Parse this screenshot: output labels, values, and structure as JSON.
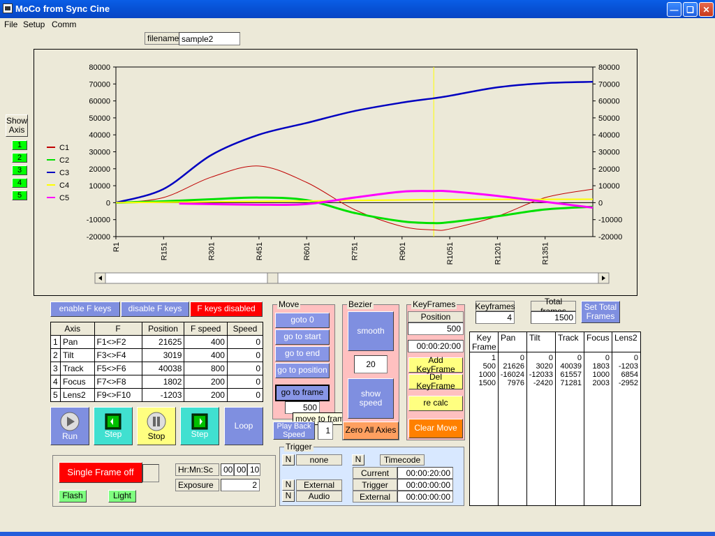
{
  "window": {
    "title": "MoCo from Sync Cine"
  },
  "menu": [
    "File",
    "Setup",
    "Comm"
  ],
  "filename": {
    "label": "filename",
    "value": "sample2"
  },
  "show_axis": {
    "label": "Show Axis",
    "buttons": [
      "1",
      "2",
      "3",
      "4",
      "5"
    ]
  },
  "chart_data": {
    "type": "line",
    "xlabels": [
      "R1",
      "R151",
      "R301",
      "R451",
      "R601",
      "R751",
      "R901",
      "R1051",
      "R1201",
      "R1351"
    ],
    "xrange": [
      1,
      1500
    ],
    "ylim": [
      -20000,
      80000
    ],
    "yticks": [
      "80000",
      "70000",
      "60000",
      "50000",
      "40000",
      "30000",
      "20000",
      "10000",
      "0",
      "-10000",
      "-20000"
    ],
    "cursor_frame": 1000,
    "series": [
      {
        "name": "C1",
        "color": "#c00000",
        "x": [
          1,
          150,
          300,
          450,
          600,
          750,
          900,
          1000,
          1050,
          1200,
          1350,
          1500
        ],
        "y": [
          0,
          3000,
          15000,
          21626,
          12000,
          -4000,
          -14000,
          -16024,
          -15500,
          -8000,
          3000,
          7976
        ]
      },
      {
        "name": "C2",
        "color": "#00e000",
        "x": [
          1,
          150,
          300,
          450,
          600,
          750,
          900,
          1000,
          1050,
          1200,
          1350,
          1500
        ],
        "y": [
          0,
          800,
          2000,
          3019,
          1500,
          -6000,
          -11000,
          -12033,
          -11500,
          -8000,
          -4000,
          -2420
        ]
      },
      {
        "name": "C3",
        "color": "#0000c0",
        "x": [
          1,
          150,
          300,
          450,
          600,
          750,
          900,
          1000,
          1050,
          1200,
          1350,
          1500
        ],
        "y": [
          0,
          8000,
          28000,
          40038,
          47000,
          54000,
          59000,
          61557,
          63000,
          68000,
          70500,
          71281
        ]
      },
      {
        "name": "C4",
        "color": "#ffff00",
        "x": [
          1,
          300,
          600,
          900,
          1000,
          1200,
          1500
        ],
        "y": [
          0,
          500,
          1000,
          1600,
          1802,
          1900,
          2003
        ]
      },
      {
        "name": "C5",
        "color": "#ff00ff",
        "x": [
          200,
          450,
          600,
          750,
          900,
          1000,
          1050,
          1200,
          1350,
          1500
        ],
        "y": [
          -500,
          -1203,
          -800,
          3000,
          6500,
          6854,
          6700,
          4000,
          500,
          -2952
        ]
      }
    ]
  },
  "fkeys": {
    "enable": "enable F keys",
    "disable": "disable F keys",
    "status": "F keys disabled"
  },
  "axis_table": {
    "headers": [
      "Axis",
      "F",
      "Position",
      "F speed",
      "Speed"
    ],
    "rows": [
      {
        "n": "1",
        "axis": "Pan",
        "f": "F1<>F2",
        "position": "21625",
        "fspeed": "400",
        "speed": "0"
      },
      {
        "n": "2",
        "axis": "Tilt",
        "f": "F3<>F4",
        "position": "3019",
        "fspeed": "400",
        "speed": "0"
      },
      {
        "n": "3",
        "axis": "Track",
        "f": "F5<>F6",
        "position": "40038",
        "fspeed": "800",
        "speed": "0"
      },
      {
        "n": "4",
        "axis": "Focus",
        "f": "F7<>F8",
        "position": "1802",
        "fspeed": "200",
        "speed": "0"
      },
      {
        "n": "5",
        "axis": "Lens2",
        "f": "F9<>F10",
        "position": "-1203",
        "fspeed": "200",
        "speed": "0"
      }
    ]
  },
  "transport": {
    "run": "Run",
    "step_back": "Step",
    "stop": "Stop",
    "step_fwd": "Step",
    "loop": "Loop"
  },
  "single_frame": {
    "status": "Single Frame off",
    "flash": "Flash",
    "light": "Light",
    "time_label": "Hr:Mn:Sc",
    "hr": "00",
    "mn": "00",
    "sc": "10",
    "exposure_label": "Exposure",
    "exposure": "2"
  },
  "move": {
    "title": "Move",
    "goto0": "goto 0",
    "start": "go to start",
    "end": "go to end",
    "position": "go to position",
    "frame": "go to frame",
    "frame_value": "500",
    "tooltip": "move to frame below",
    "playback_label": "Play Back Speed",
    "playback_value": "1"
  },
  "bezier": {
    "title": "Bezier",
    "smooth": "smooth",
    "value": "20",
    "show_speed": "show speed",
    "zero": "Zero All Axies"
  },
  "keyframes_panel": {
    "title": "KeyFrames",
    "position_label": "Position",
    "position_value": "500",
    "time": "00:00:20:00",
    "add": "Add KeyFrame",
    "del": "Del KeyFrame",
    "recalc": "re calc",
    "clear": "Clear Move"
  },
  "counts": {
    "keyframes_label": "Keyframes",
    "keyframes": "4",
    "total_label": "Total frames",
    "total": "1500",
    "set_total": "Set Total Frames"
  },
  "keyframe_table": {
    "columns": [
      {
        "head": "Key Frame",
        "values": [
          "1",
          "500",
          "1000",
          "1500"
        ]
      },
      {
        "head": "Pan",
        "values": [
          "0",
          "21626",
          "-16024",
          "7976"
        ]
      },
      {
        "head": "Tilt",
        "values": [
          "0",
          "3020",
          "-12033",
          "-2420"
        ]
      },
      {
        "head": "Track",
        "values": [
          "0",
          "40039",
          "61557",
          "71281"
        ]
      },
      {
        "head": "Focus",
        "values": [
          "0",
          "1803",
          "1000",
          "2003"
        ]
      },
      {
        "head": "Lens2",
        "values": [
          "0",
          "-1203",
          "6854",
          "-2952"
        ]
      }
    ]
  },
  "trigger": {
    "title": "Trigger",
    "n": "N",
    "none": "none",
    "timecode": "Timecode",
    "external": "External",
    "audio": "Audio",
    "current_label": "Current",
    "current": "00:00:20:00",
    "trigger_label": "Trigger",
    "trigger": "00:00:00:00",
    "external_label": "External",
    "external_value": "00:00:00:00"
  }
}
